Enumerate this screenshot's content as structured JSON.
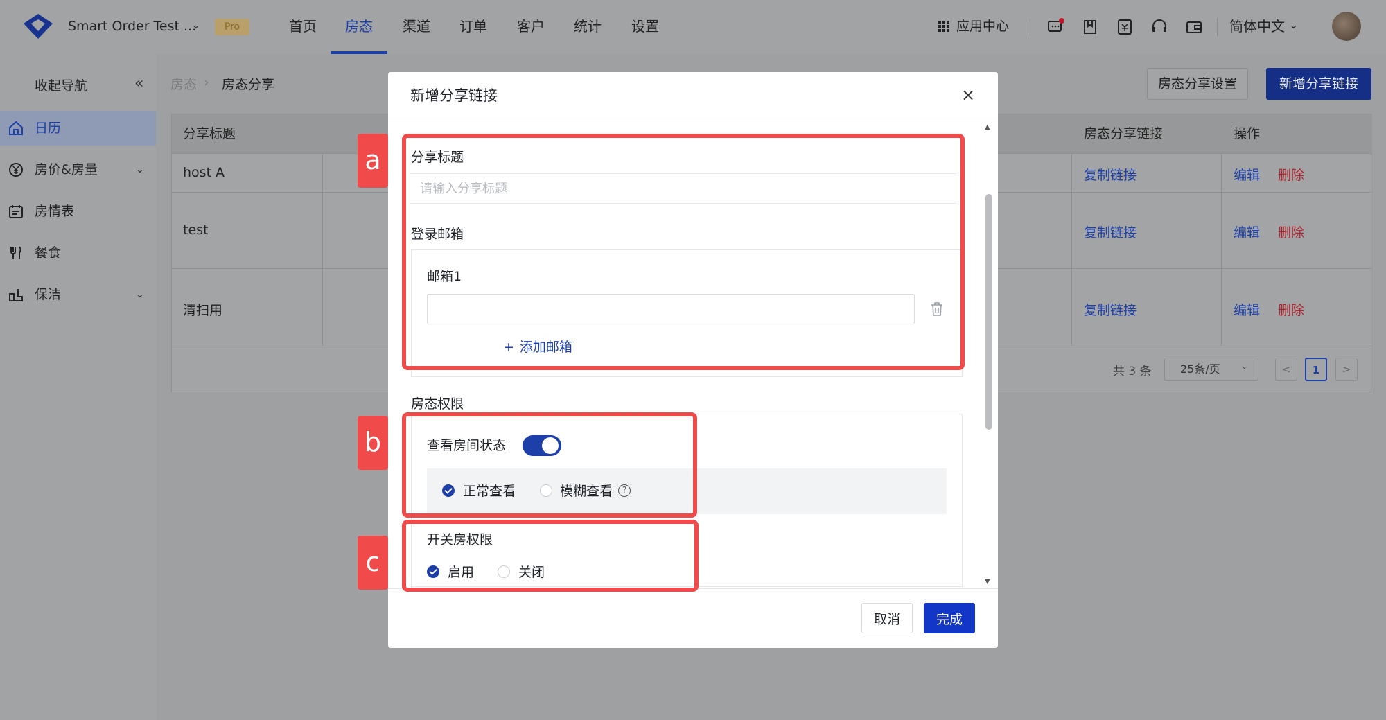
{
  "topbar": {
    "app_name": "Smart Order Test ...",
    "badge": "Pro",
    "nav": [
      "首页",
      "房态",
      "渠道",
      "订单",
      "客户",
      "统计",
      "设置"
    ],
    "active_nav": "房态",
    "app_center": "应用中心",
    "language": "简体中文",
    "icons": [
      "message-icon",
      "book-icon",
      "invoice-icon",
      "headset-icon",
      "wallet-icon"
    ]
  },
  "sidebar": {
    "collapse_label": "收起导航",
    "items": [
      {
        "label": "日历",
        "icon": "home-icon",
        "active": true
      },
      {
        "label": "房价&房量",
        "icon": "yen-icon",
        "expandable": true
      },
      {
        "label": "房情表",
        "icon": "calendar-list-icon"
      },
      {
        "label": "餐食",
        "icon": "fork-knife-icon"
      },
      {
        "label": "保洁",
        "icon": "cleaning-icon",
        "expandable": true
      }
    ]
  },
  "page": {
    "breadcrumb": [
      "房态",
      "房态分享"
    ],
    "btn_settings": "房态分享设置",
    "btn_new": "新增分享链接"
  },
  "table": {
    "headers": {
      "title": "分享标题",
      "link": "房态分享链接",
      "ops": "操作"
    },
    "rows": [
      {
        "title": "host A",
        "link": "复制链接",
        "edit": "编辑",
        "delete": "删除"
      },
      {
        "title": "test",
        "link": "复制链接",
        "edit": "编辑",
        "delete": "删除"
      },
      {
        "title": "清扫用",
        "link": "复制链接",
        "edit": "编辑",
        "delete": "删除"
      }
    ],
    "pagination": {
      "total": "共 3 条",
      "page_size": "25条/页",
      "prev": "<",
      "current": "1",
      "next": ">"
    }
  },
  "modal": {
    "title": "新增分享链接",
    "close": "×",
    "share_title_label": "分享标题",
    "share_title_placeholder": "请输入分享标题",
    "login_email_label": "登录邮箱",
    "email1_label": "邮箱1",
    "add_email": "添加邮箱",
    "add_icon": "+",
    "perm_label": "房态权限",
    "view_status_label": "查看房间状态",
    "view_status_on": true,
    "view_normal": "正常查看",
    "view_fuzzy": "模糊查看",
    "help": "?",
    "switch_perm_label": "开关房权限",
    "enable": "启用",
    "disable": "关闭",
    "cancel": "取消",
    "done": "完成"
  },
  "annotations": {
    "a": "a",
    "b": "b",
    "c": "c",
    "color": "#f04a4a"
  }
}
